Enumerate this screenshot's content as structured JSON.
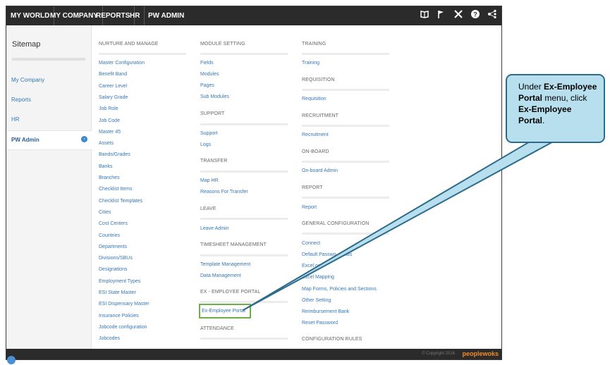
{
  "topnav": {
    "items": [
      "MY WORLD",
      "MY COMPANY",
      "REPORTS",
      "HR",
      "PW ADMIN"
    ]
  },
  "sidebar": {
    "title": "Sitemap",
    "items": [
      "My Company",
      "Reports",
      "HR",
      "PW Admin"
    ]
  },
  "columns": {
    "nurture": {
      "heading": "NURTURE AND MANAGE",
      "links": [
        "Master Configuration",
        "Benefit Band",
        "Career Level",
        "Salary Grade",
        "Job Role",
        "Job Code",
        "Master 45",
        "Assets",
        "Bands/Grades",
        "Banks",
        "Branches",
        "Checklist Items",
        "Checklist Templates",
        "Cities",
        "Cost Centers",
        "Countries",
        "Departments",
        "Divisions/SBUs",
        "Designations",
        "Employment Types",
        "ESI State Master",
        "ESI Dispensary Master",
        "Insurance Policies",
        "Jobcode configuration",
        "Jobcodes"
      ]
    },
    "module_setting": {
      "heading": "MODULE SETTING",
      "links": [
        "Fields",
        "Modules",
        "Pages",
        "Sub Modules"
      ]
    },
    "support": {
      "heading": "SUPPORT",
      "links": [
        "Support",
        "Logs"
      ]
    },
    "transfer": {
      "heading": "TRANSFER",
      "links": [
        "Map HR",
        "Reasons For Transfer"
      ]
    },
    "leave": {
      "heading": "LEAVE",
      "links": [
        "Leave Admin"
      ]
    },
    "timesheet": {
      "heading": "TIMESHEET MANAGEMENT",
      "links": [
        "Template Management",
        "Data Management"
      ]
    },
    "ex_employee": {
      "heading": "EX - EMPLOYEE PORTAL",
      "links": [
        "Ex-Employee Portal"
      ]
    },
    "attendance": {
      "heading": "ATTENDANCE"
    },
    "training": {
      "heading": "TRAINING",
      "links": [
        "Training"
      ]
    },
    "requisition": {
      "heading": "REQUISITION",
      "links": [
        "Requisition"
      ]
    },
    "recruitment": {
      "heading": "RECRUITMENT",
      "links": [
        "Recruitment"
      ]
    },
    "onboard": {
      "heading": "ON-BOARD",
      "links": [
        "On-board Admin"
      ]
    },
    "report": {
      "heading": "REPORT",
      "links": [
        "Report"
      ]
    },
    "general_config": {
      "heading": "GENERAL CONFIGURATION",
      "links": [
        "Connect",
        "Default Passwo",
        "Excel",
        "Excel Mapping",
        "Map Forms, Policies and Sections",
        "Other Setting",
        "Reimbursement Bank",
        "Reset Password"
      ],
      "partial_tails": [
        "ntials",
        "oad"
      ]
    },
    "config_rules": {
      "heading": "CONFIGURATION RULES"
    }
  },
  "footer": {
    "copyright": "© Copyright 2016",
    "brand": "peoplewoks"
  },
  "callout": {
    "part1": "Under ",
    "bold1": "Ex-Employee Portal",
    "part2": " menu, click ",
    "bold2": "Ex-Employee Portal",
    "part3": "."
  },
  "colors": {
    "topbar": "#2b2b2b",
    "link": "#3677b5",
    "callout_bg": "#b8dfee",
    "callout_border": "#2d6b8a",
    "highlight": "#70ad47"
  }
}
